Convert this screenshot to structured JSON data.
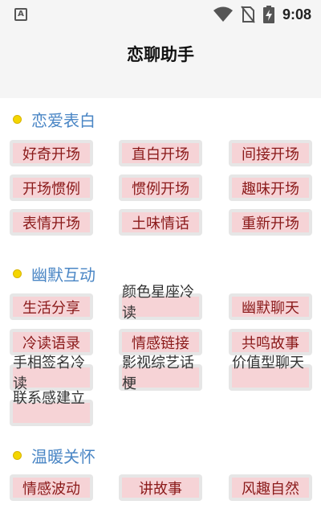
{
  "status": {
    "time": "9:08",
    "left_icon": "A",
    "icons": [
      "wifi-icon",
      "no-sim-icon",
      "battery-charging-icon"
    ]
  },
  "app": {
    "title": "恋聊助手"
  },
  "sections": [
    {
      "title": "恋爱表白",
      "items": [
        "好奇开场",
        "直白开场",
        "间接开场",
        "开场惯例",
        "惯例开场",
        "趣味开场",
        "表情开场",
        "土味情话",
        "重新开场"
      ]
    },
    {
      "title": "幽默互动",
      "items": [
        "生活分享",
        "颜色星座冷读",
        "幽默聊天",
        "冷读语录",
        "情感链接",
        "共鸣故事",
        "手相签名冷读",
        "影视综艺话梗",
        "价值型聊天",
        "联系感建立"
      ]
    },
    {
      "title": "温暖关怀",
      "items": [
        "情感波动",
        "讲故事",
        "风趣自然"
      ]
    }
  ],
  "colors": {
    "accent": "#4a86c5",
    "chip_bg": "#f6d3d6",
    "chip_text": "#8b1a1a",
    "dot": "#f4d600"
  }
}
